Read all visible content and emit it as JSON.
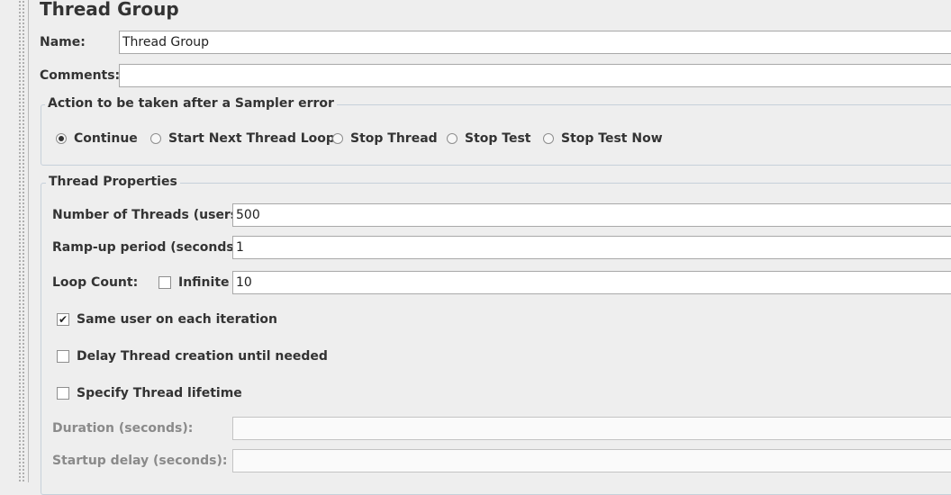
{
  "panel": {
    "title": "Thread Group",
    "name_label": "Name:",
    "name_value": "Thread Group",
    "comments_label": "Comments:",
    "comments_value": ""
  },
  "sampler_error": {
    "legend": "Action to be taken after a Sampler error",
    "options": [
      {
        "label": "Continue",
        "selected": true
      },
      {
        "label": "Start Next Thread Loop",
        "selected": false
      },
      {
        "label": "Stop Thread",
        "selected": false
      },
      {
        "label": "Stop Test",
        "selected": false
      },
      {
        "label": "Stop Test Now",
        "selected": false
      }
    ]
  },
  "thread_properties": {
    "legend": "Thread Properties",
    "threads_label": "Number of Threads (users):",
    "threads_value": "500",
    "rampup_label": "Ramp-up period (seconds):",
    "rampup_value": "1",
    "loop_label": "Loop Count:",
    "infinite_label": "Infinite",
    "infinite_checked": false,
    "loop_value": "10",
    "same_user_label": "Same user on each iteration",
    "same_user_checked": true,
    "delay_label": "Delay Thread creation until needed",
    "delay_checked": false,
    "lifetime_label": "Specify Thread lifetime",
    "lifetime_checked": false,
    "duration_label": "Duration (seconds):",
    "duration_value": "",
    "startup_label": "Startup delay (seconds):",
    "startup_value": ""
  }
}
